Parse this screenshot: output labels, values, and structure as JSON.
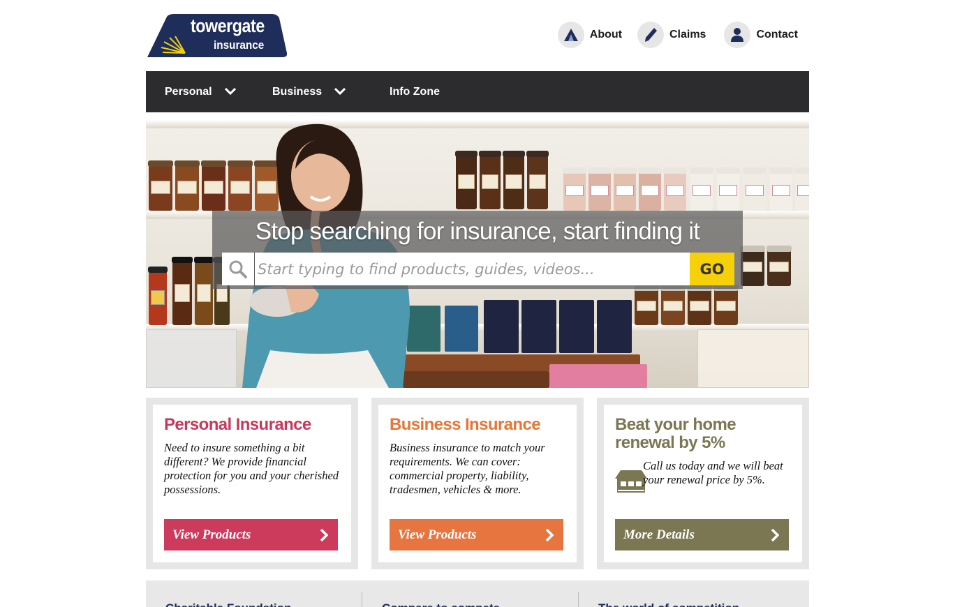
{
  "brand": {
    "logo_line1": "towergate",
    "logo_line2": "insurance",
    "navy": "#1f2d5a",
    "yellow": "#f6d10a"
  },
  "top_links": [
    {
      "label": "About",
      "icon": "sail-icon"
    },
    {
      "label": "Claims",
      "icon": "pen-icon"
    },
    {
      "label": "Contact",
      "icon": "person-icon"
    }
  ],
  "nav": {
    "items": [
      {
        "label": "Personal",
        "has_dropdown": true
      },
      {
        "label": "Business",
        "has_dropdown": true
      },
      {
        "label": "Info Zone",
        "has_dropdown": false
      }
    ]
  },
  "hero": {
    "title": "Stop searching for insurance, start finding it",
    "search_placeholder": "Start typing to find products, guides, videos...",
    "search_value": "",
    "go_label": "GO"
  },
  "cards": [
    {
      "title": "Personal Insurance",
      "text": "Need to insure something a bit different? We provide financial protection for you and your cherished possessions.",
      "button": "View Products",
      "color": "#cc3a5c"
    },
    {
      "title": "Business Insurance",
      "text": "Business insurance to match your requirements. We can cover: commercial property, liability, tradesmen, vehicles & more.",
      "button": "View Products",
      "color": "#e77540"
    },
    {
      "title": "Beat your home renewal by 5%",
      "text": "Call us today and we will beat your renewal price by 5%.",
      "button": "More Details",
      "color": "#7a7752",
      "icon": "house-icon"
    }
  ],
  "bottom_strip": [
    {
      "label": "Charitable Foundation"
    },
    {
      "label": "Compare to compete"
    },
    {
      "label": "The world of competition"
    }
  ]
}
